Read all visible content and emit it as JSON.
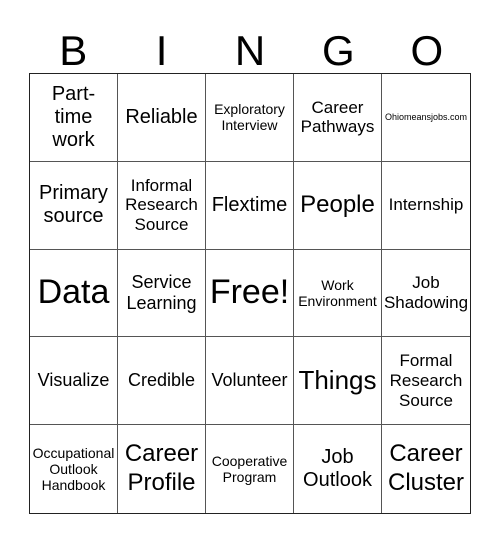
{
  "header": {
    "letters": [
      "B",
      "I",
      "N",
      "G",
      "O"
    ]
  },
  "board": {
    "cells": [
      {
        "text": "Part-\ntime\nwork",
        "size": "fs-m"
      },
      {
        "text": "Reliable",
        "size": "fs-m"
      },
      {
        "text": "Exploratory\nInterview",
        "size": "fs-xs"
      },
      {
        "text": "Career\nPathways",
        "size": "fs-s"
      },
      {
        "text": "Ohiomeansjobs.com",
        "size": "fs-xxs"
      },
      {
        "text": "Primary\nsource",
        "size": "fs-m"
      },
      {
        "text": "Informal\nResearch\nSource",
        "size": "fs-s"
      },
      {
        "text": "Flextime",
        "size": "fs-m"
      },
      {
        "text": "People",
        "size": "fs-lm"
      },
      {
        "text": "Internship",
        "size": "fs-s"
      },
      {
        "text": "Data",
        "size": "fs-xl"
      },
      {
        "text": "Service\nLearning",
        "size": "fs-ms"
      },
      {
        "text": "Free!",
        "size": "fs-xl"
      },
      {
        "text": "Work\nEnvironment",
        "size": "fs-xs"
      },
      {
        "text": "Job\nShadowing",
        "size": "fs-s"
      },
      {
        "text": "Visualize",
        "size": "fs-ms"
      },
      {
        "text": "Credible",
        "size": "fs-ms"
      },
      {
        "text": "Volunteer",
        "size": "fs-ms"
      },
      {
        "text": "Things",
        "size": "fs-l"
      },
      {
        "text": "Formal\nResearch\nSource",
        "size": "fs-s"
      },
      {
        "text": "Occupational\nOutlook\nHandbook",
        "size": "fs-xs"
      },
      {
        "text": "Career\nProfile",
        "size": "fs-lm"
      },
      {
        "text": "Cooperative\nProgram",
        "size": "fs-xs"
      },
      {
        "text": "Job\nOutlook",
        "size": "fs-m"
      },
      {
        "text": "Career\nCluster",
        "size": "fs-lm"
      }
    ]
  }
}
